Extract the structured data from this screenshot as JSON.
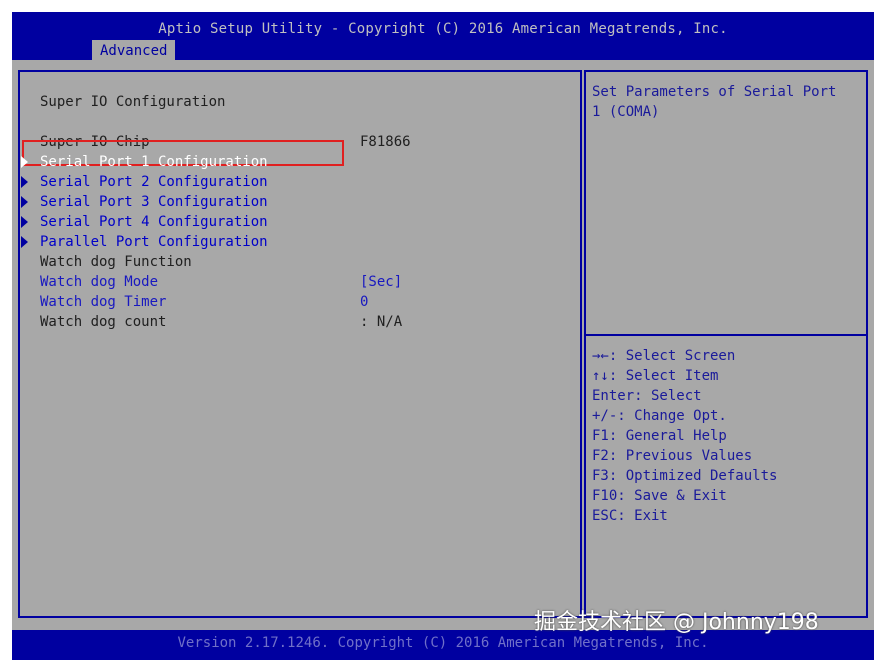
{
  "header": {
    "title": "Aptio Setup Utility - Copyright (C) 2016 American Megatrends, Inc.",
    "active_tab": "Advanced"
  },
  "main": {
    "section_title": "Super IO Configuration",
    "chip_label": "Super IO Chip",
    "chip_value": "F81866",
    "menu_items": [
      {
        "label": "Serial Port 1 Configuration",
        "selected": true
      },
      {
        "label": "Serial Port 2 Configuration"
      },
      {
        "label": "Serial Port 3 Configuration"
      },
      {
        "label": "Serial Port 4 Configuration"
      },
      {
        "label": "Parallel Port Configuration"
      }
    ],
    "watchdog": {
      "function_label": "Watch dog Function",
      "mode_label": "Watch dog Mode",
      "mode_value": "[Sec]",
      "timer_label": "Watch dog Timer",
      "timer_value": "0",
      "count_label": "Watch dog count",
      "count_value": ": N/A"
    }
  },
  "help": {
    "description": "Set Parameters of Serial Port 1 (COMA)",
    "keys": [
      "→←: Select Screen",
      "↑↓: Select Item",
      "Enter: Select",
      "+/-: Change Opt.",
      "F1: General Help",
      "F2: Previous Values",
      "F3: Optimized Defaults",
      "F10: Save & Exit",
      "ESC: Exit"
    ]
  },
  "footer": {
    "version": "Version 2.17.1246. Copyright (C) 2016 American Megatrends, Inc."
  },
  "watermark": "掘金技术社区 @ Johnny198",
  "colors": {
    "bios_blue": "#0000a0",
    "panel_gray": "#a8a8a8",
    "highlight_red": "#e02020"
  }
}
